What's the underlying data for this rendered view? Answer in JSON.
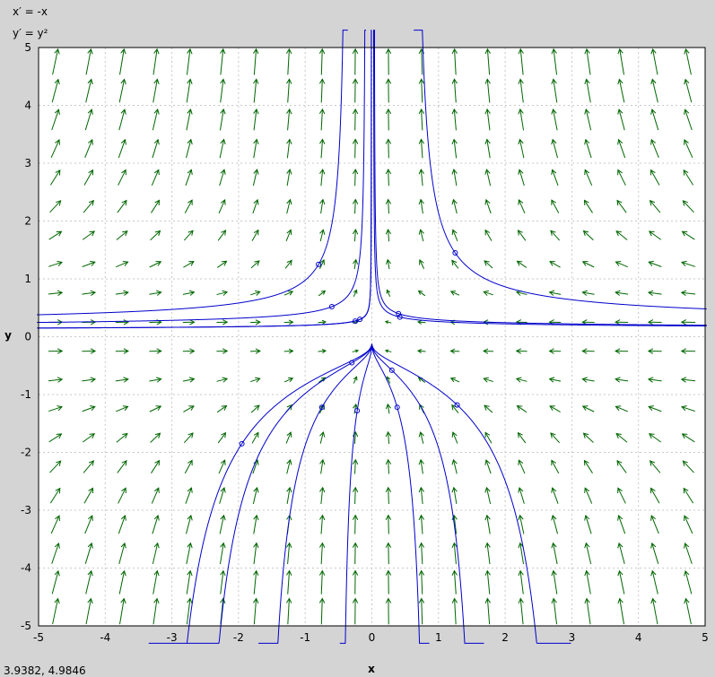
{
  "equations": {
    "x_prime": "x′ = -x",
    "y_prime": "y′ = y²"
  },
  "coordinate_readout": "3.9382, 4.9846",
  "chart_data": {
    "type": "vector_field",
    "xlabel": "x",
    "ylabel": "y",
    "xlim": [
      -5,
      5
    ],
    "ylim": [
      -5,
      5
    ],
    "xticks": [
      -5,
      -4,
      -3,
      -2,
      -1,
      0,
      1,
      2,
      3,
      4,
      5
    ],
    "yticks": [
      -5,
      -4,
      -3,
      -2,
      -1,
      0,
      1,
      2,
      3,
      4,
      5
    ],
    "grid": true,
    "field": {
      "dx": "-x",
      "dy": "y^2",
      "arrow_color": "#006600",
      "grid_step": 0.5
    },
    "trajectory_color": "#0000cc",
    "initial_points": [
      {
        "x": 1.25,
        "y": 1.45
      },
      {
        "x": -0.8,
        "y": 1.25
      },
      {
        "x": -0.6,
        "y": 0.52
      },
      {
        "x": -0.25,
        "y": 0.27
      },
      {
        "x": -0.18,
        "y": 0.3
      },
      {
        "x": 0.4,
        "y": 0.4
      },
      {
        "x": 0.42,
        "y": 0.34
      },
      {
        "x": -0.3,
        "y": -0.45
      },
      {
        "x": 0.3,
        "y": -0.58
      },
      {
        "x": -0.75,
        "y": -1.22
      },
      {
        "x": -0.22,
        "y": -1.28
      },
      {
        "x": 0.38,
        "y": -1.22
      },
      {
        "x": 1.28,
        "y": -1.18
      },
      {
        "x": -1.95,
        "y": -1.85
      }
    ]
  }
}
